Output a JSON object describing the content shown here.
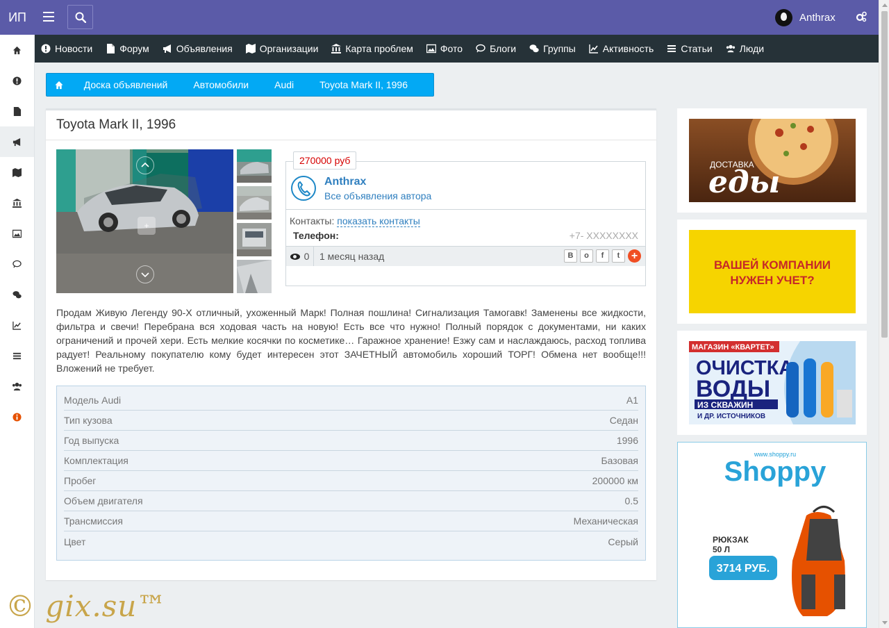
{
  "app": {
    "logo": "ИП",
    "username": "Anthrax"
  },
  "nav": {
    "items": [
      {
        "label": "Новости",
        "icon": "exclamation-circle-icon"
      },
      {
        "label": "Форум",
        "icon": "file-icon"
      },
      {
        "label": "Объявления",
        "icon": "bullhorn-icon"
      },
      {
        "label": "Организации",
        "icon": "map-icon"
      },
      {
        "label": "Карта проблем",
        "icon": "bank-icon"
      },
      {
        "label": "Фото",
        "icon": "image-icon"
      },
      {
        "label": "Блоги",
        "icon": "comment-icon"
      },
      {
        "label": "Группы",
        "icon": "comments-icon"
      },
      {
        "label": "Активность",
        "icon": "line-chart-icon"
      },
      {
        "label": "Статьи",
        "icon": "list-icon"
      },
      {
        "label": "Люди",
        "icon": "users-icon"
      }
    ]
  },
  "sidebar": {
    "icons": [
      "home-icon",
      "exclamation-circle-icon",
      "file-icon",
      "bullhorn-icon",
      "map-icon",
      "bank-icon",
      "image-icon",
      "comment-icon",
      "comments-icon",
      "line-chart-icon",
      "list-icon",
      "users-icon",
      "info-circle-icon"
    ],
    "active_index": 3
  },
  "breadcrumb": [
    "Доска объявлений",
    "Автомобили",
    "Audi",
    "Toyota Mark II, 1996"
  ],
  "listing": {
    "title": "Toyota Mark II, 1996",
    "price": "270000 руб",
    "author": "Anthrax",
    "author_link": "Все объявления автора",
    "contacts_label": "Контакты:",
    "contacts_link": "показать контакты",
    "phone_label": "Телефон:",
    "phone_value": "+7- XXXXXXXX",
    "views": "0",
    "posted": "1 месяц назад",
    "share_buttons": [
      "В",
      "о",
      "f",
      "t",
      "+"
    ],
    "description": "Продам Живую Легенду 90-Х отличный, ухоженный Марк! Полная пошлина! Сигнализация Тамогавк! Заменены все жидкости, фильтра и свечи! Перебрана вся ходовая часть на новую! Есть все что нужно! Полный порядок с документами, ни каких ограничений и прочей хери. Есть мелкие косячки по косметике… Гаражное хранение! Езжу сам и наслаждаюсь, расход топлива радует! Реальному покупателю кому будет интересен этот ЗАЧЕТНЫЙ автомобиль хороший ТОРГ! Обмена нет вообще!!! Вложений не требует.",
    "specs": [
      {
        "label": "Модель Audi",
        "value": "A1"
      },
      {
        "label": "Тип кузова",
        "value": "Седан"
      },
      {
        "label": "Год выпуска",
        "value": "1996"
      },
      {
        "label": "Комплектация",
        "value": "Базовая"
      },
      {
        "label": "Пробег",
        "value": "200000 км"
      },
      {
        "label": "Объем двигателя",
        "value": "0.5"
      },
      {
        "label": "Трансмиссия",
        "value": "Механическая"
      },
      {
        "label": "Цвет",
        "value": "Серый"
      }
    ]
  },
  "ads": {
    "ad1": {
      "text1": "ДОСТАВКА",
      "text2": "еды"
    },
    "ad2": {
      "line1": "ВАШЕЙ КОМПАНИИ",
      "line2": "НУЖЕН УЧЕТ?"
    },
    "ad3": {
      "shop": "МАГАЗИН «КВАРТЕТ»",
      "line1": "ОЧИСТКА",
      "line2": "ВОДЫ",
      "line3": "ИЗ СКВАЖИН",
      "line4": "И ДР. ИСТОЧНИКОВ"
    },
    "ad4": {
      "url": "www.shoppy.ru",
      "brand": "Shoppy",
      "item1": "РЮКЗАК",
      "item2": "50 Л",
      "price": "3714 РУБ."
    }
  },
  "watermark": "© gix.su™",
  "colors": {
    "topbar": "#5b5ba8",
    "navbar": "#263238",
    "breadcrumb": "#03a9f4",
    "price": "#d60000",
    "link": "#2f7fbf"
  }
}
